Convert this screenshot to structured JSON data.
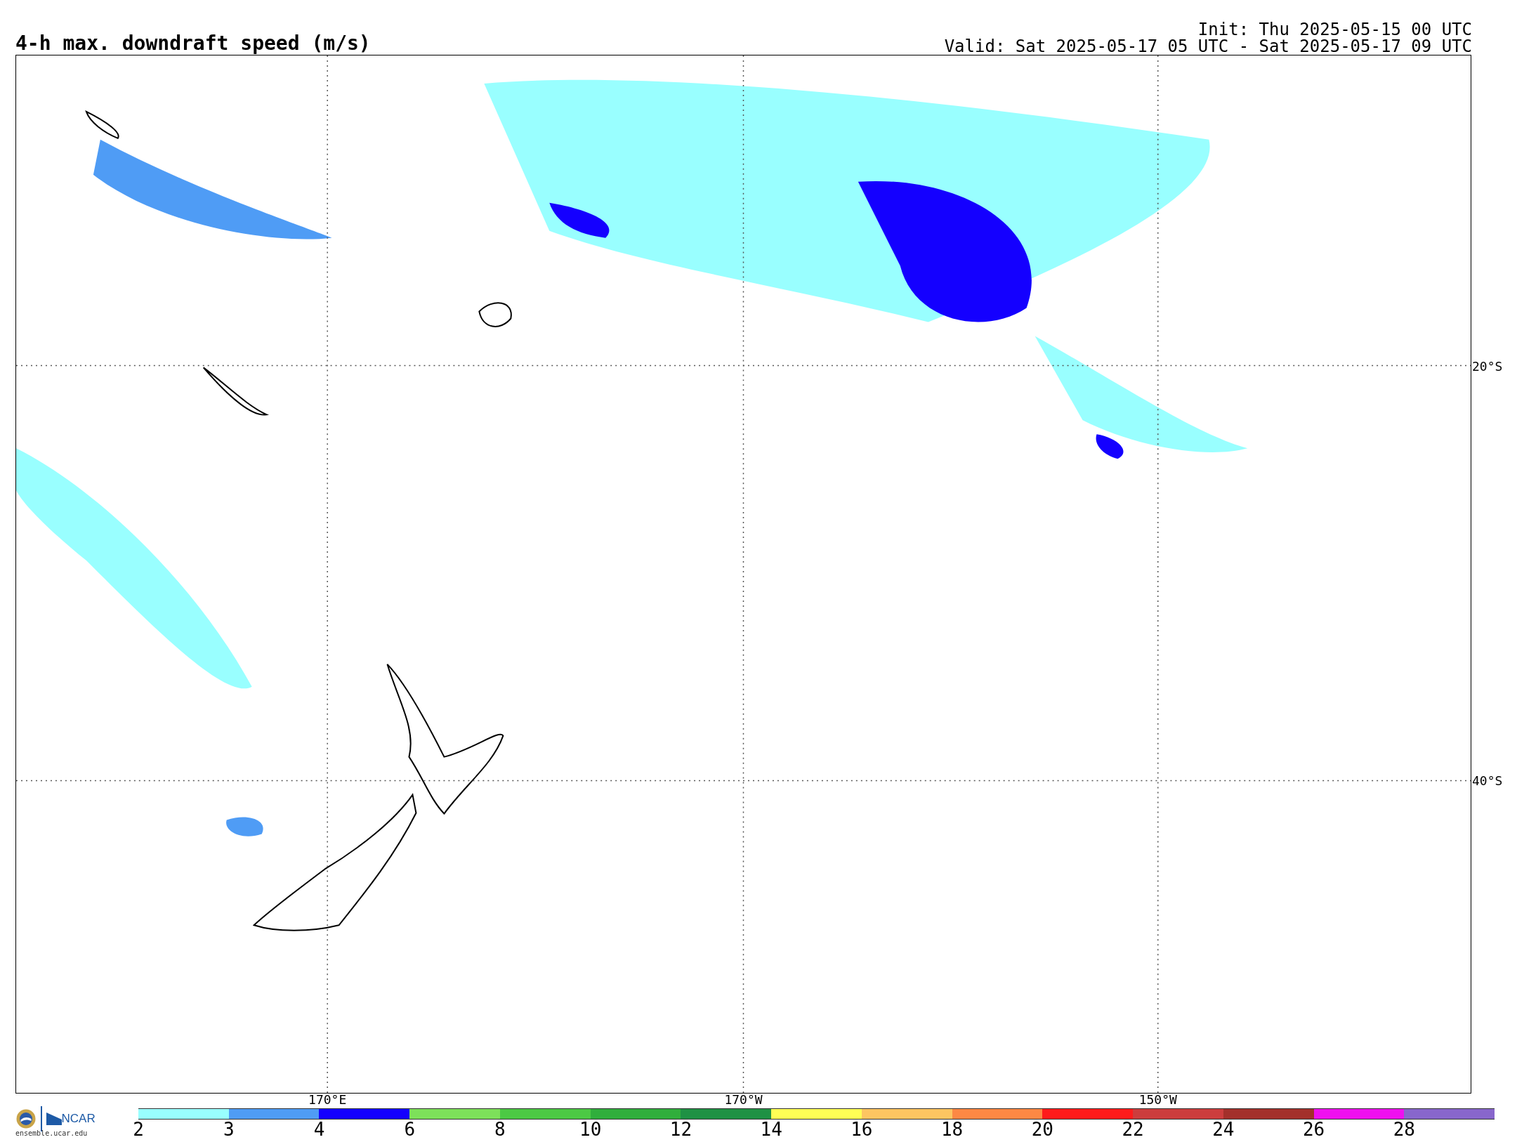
{
  "title": "4-h max. downdraft speed (m/s)",
  "init": "Init: Thu 2025-05-15 00 UTC",
  "valid": "Valid: Sat 2025-05-17 05 UTC - Sat 2025-05-17 09 UTC",
  "map": {
    "longitude_labels": [
      "170°E",
      "170°W",
      "150°W"
    ],
    "latitude_labels": [
      "20°S",
      "40°S"
    ]
  },
  "logo": {
    "agency": "NCAR",
    "site": "ensemble.ucar.edu"
  },
  "colorbar": {
    "bins": [
      {
        "label": "2",
        "color": "#99ffff"
      },
      {
        "label": "3",
        "color": "#4f9cf5"
      },
      {
        "label": "4",
        "color": "#1400ff"
      },
      {
        "label": "6",
        "color": "#7de05a"
      },
      {
        "label": "8",
        "color": "#4cc944"
      },
      {
        "label": "10",
        "color": "#30ae3c"
      },
      {
        "label": "12",
        "color": "#1f9144"
      },
      {
        "label": "14",
        "color": "#ffff55"
      },
      {
        "label": "16",
        "color": "#fdc561"
      },
      {
        "label": "18",
        "color": "#fd8844"
      },
      {
        "label": "20",
        "color": "#fe1b1b"
      },
      {
        "label": "22",
        "color": "#cc3d3d"
      },
      {
        "label": "24",
        "color": "#a3302b"
      },
      {
        "label": "26",
        "color": "#ef10ef"
      },
      {
        "label": "28",
        "color": "#8866cc"
      }
    ]
  }
}
